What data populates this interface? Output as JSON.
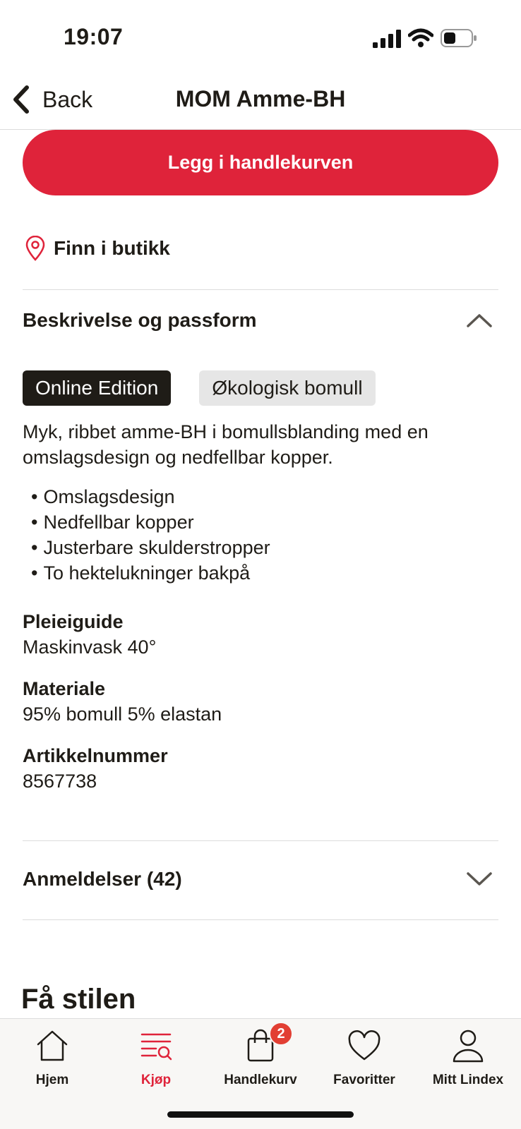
{
  "status": {
    "time": "19:07"
  },
  "nav": {
    "back_label": "Back",
    "title": "MOM Amme-BH"
  },
  "product": {
    "add_to_cart_label": "Legg i handlekurven",
    "find_in_store_label": "Finn i butikk",
    "description_section": {
      "title": "Beskrivelse og passform",
      "tags": [
        "Online Edition",
        "Økologisk bomull"
      ],
      "text": "Myk, ribbet amme-BH i bomullsblanding med en omslagsdesign og nedfellbar kopper.",
      "bullets": [
        "Omslagsdesign",
        "Nedfellbar kopper",
        "Justerbare skulderstropper",
        "To hektelukninger bakpå"
      ],
      "care_label": "Pleieiguide",
      "care_value": "Maskinvask 40°",
      "material_label": "Materiale",
      "material_value": "95% bomull 5% elastan",
      "article_label": "Artikkelnummer",
      "article_value": "8567738"
    },
    "reviews_section": {
      "title": "Anmeldelser (42)"
    },
    "style_title": "Få stilen"
  },
  "tabbar": {
    "items": [
      {
        "label": "Hjem",
        "icon": "home-icon",
        "active": false
      },
      {
        "label": "Kjøp",
        "icon": "shop-search-icon",
        "active": true
      },
      {
        "label": "Handlekurv",
        "icon": "shopping-bag-icon",
        "active": false,
        "badge": "2"
      },
      {
        "label": "Favoritter",
        "icon": "heart-icon",
        "active": false
      },
      {
        "label": "Mitt Lindex",
        "icon": "user-icon",
        "active": false
      }
    ]
  },
  "colors": {
    "accent": "#df233a",
    "text": "#1f1c17",
    "tag_dark": "#1f1c17",
    "tag_light": "#e6e6e6",
    "badge": "#e23f33"
  }
}
